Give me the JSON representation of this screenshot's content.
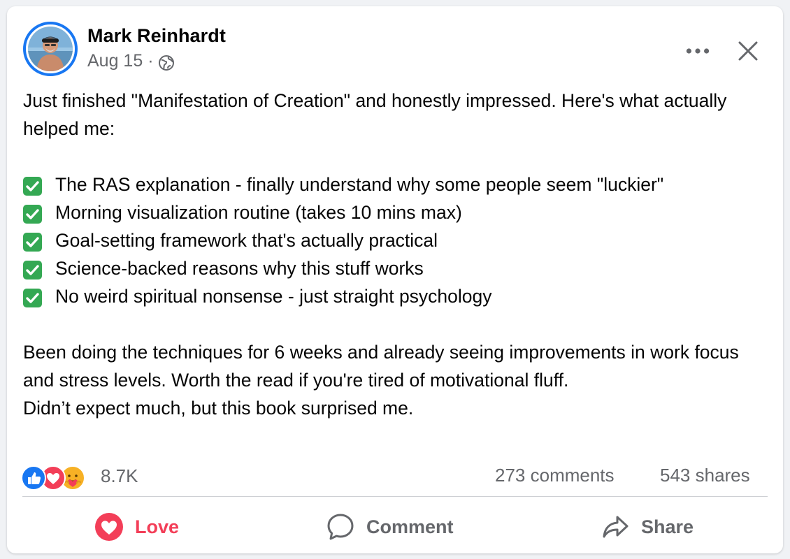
{
  "post": {
    "author": "Mark Reinhardt",
    "date": "Aug 15",
    "separator": "·",
    "privacy_icon": "globe-icon",
    "intro": "Just finished \"Manifestation of Creation\" and honestly impressed. Here's what actually helped me:",
    "checklist": [
      "The RAS explanation - finally understand why some people seem \"luckier\"",
      "Morning visualization routine (takes 10 mins max)",
      "Goal-setting framework that's actually practical",
      "Science-backed reasons why this stuff works",
      "No weird spiritual nonsense - just straight psychology"
    ],
    "para1": "Been doing the techniques for 6 weeks and already seeing improvements in work focus and stress levels. Worth the read if you're tired of motivational fluff.",
    "para2": "Didn’t expect much, but this book surprised me."
  },
  "stats": {
    "reaction_icons": [
      "like-icon",
      "love-icon",
      "care-icon"
    ],
    "reactions": "8.7K",
    "comments": "273 comments",
    "shares": "543 shares"
  },
  "actions": {
    "love": "Love",
    "comment": "Comment",
    "share": "Share"
  },
  "colors": {
    "accent_blue": "#1877f2",
    "love_red": "#f33e58",
    "secondary_text": "#65676b",
    "check_green": "#34a853"
  }
}
